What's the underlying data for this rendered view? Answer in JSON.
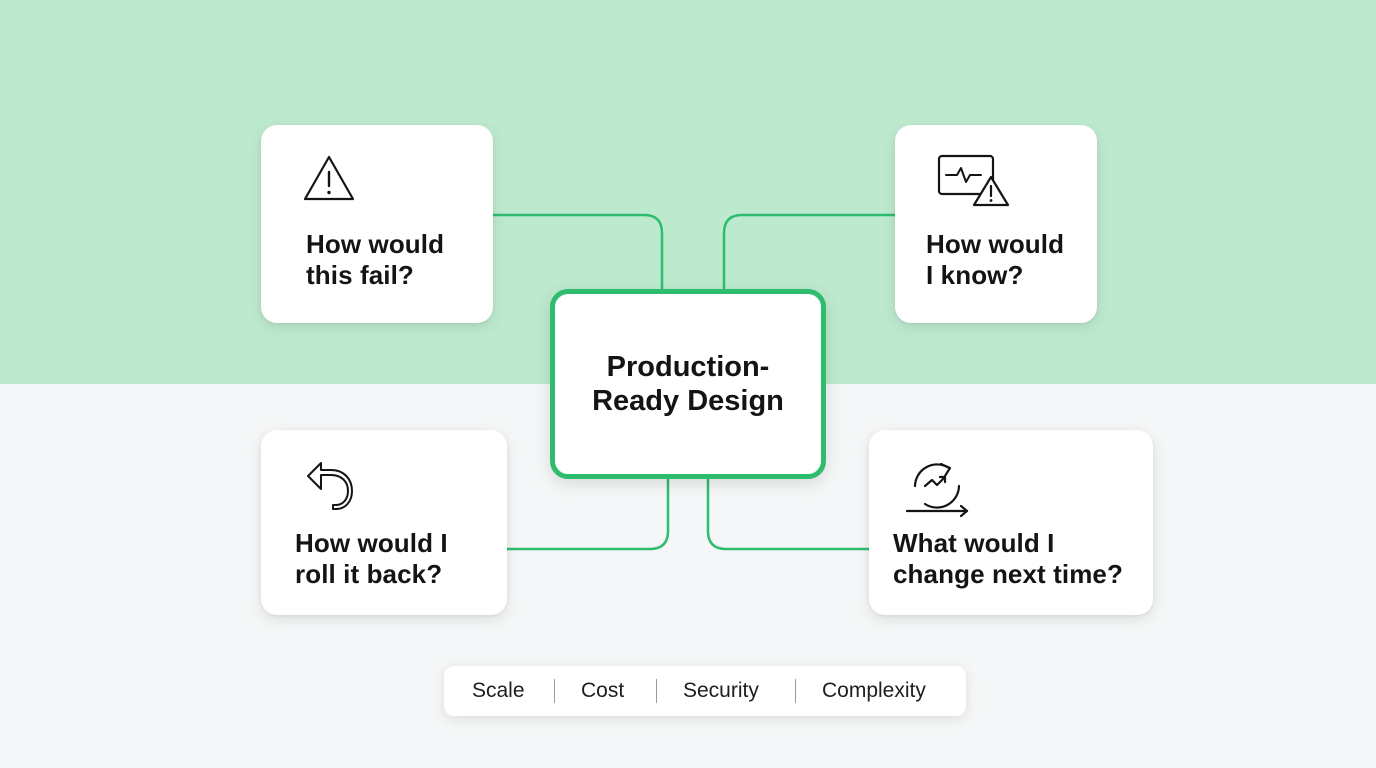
{
  "center": {
    "title": "Production-\nReady Design"
  },
  "questions": [
    {
      "id": "fail",
      "icon": "warning-triangle-icon",
      "text": "How would\nthis fail?"
    },
    {
      "id": "know",
      "icon": "monitor-alert-icon",
      "text": "How would\nI know?"
    },
    {
      "id": "rollback",
      "icon": "undo-arrow-icon",
      "text": "How would I\nroll it back?"
    },
    {
      "id": "change",
      "icon": "cycle-trend-icon",
      "text": "What would I\nchange next time?"
    }
  ],
  "tags": [
    "Scale",
    "Cost",
    "Security",
    "Complexity"
  ],
  "colors": {
    "top_background": "#bdeacf",
    "bottom_background": "#f4f6f7",
    "accent_green": "#2ebd6e",
    "card_background": "#ffffff",
    "text": "#141414"
  }
}
